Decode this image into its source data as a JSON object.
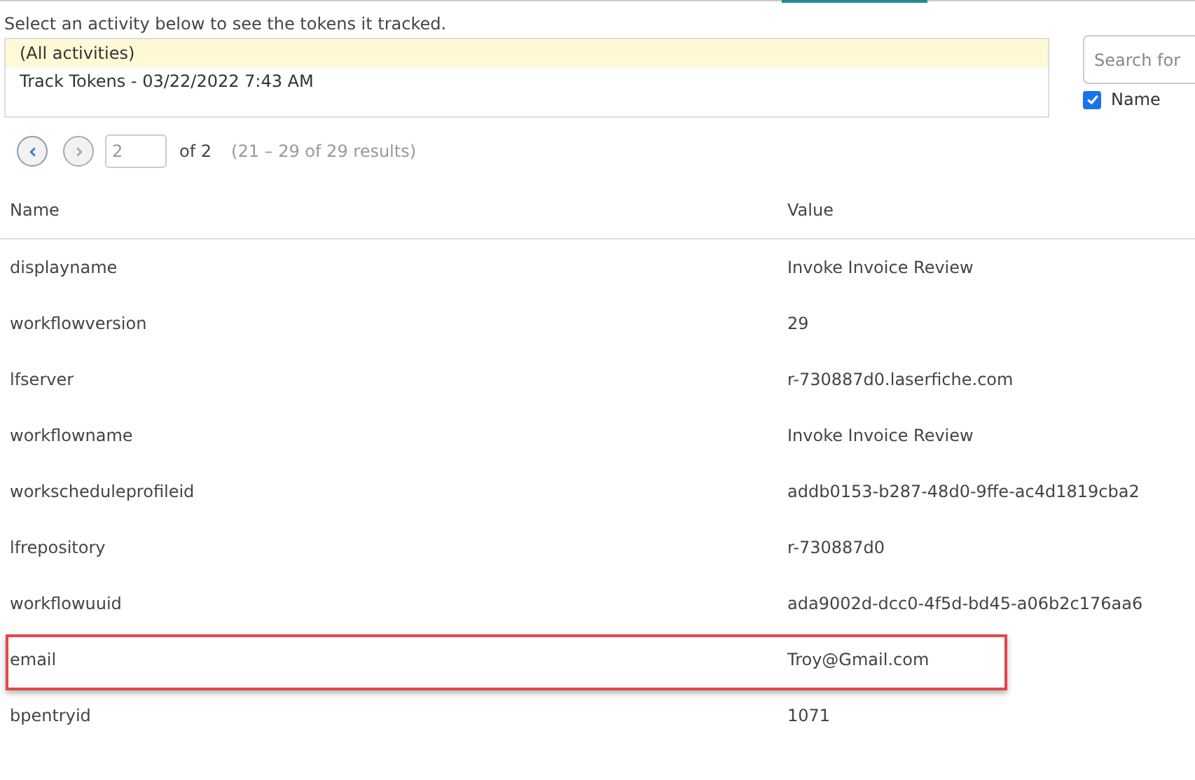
{
  "instruction": "Select an activity below to see the tokens it tracked.",
  "activities": [
    {
      "label": "(All activities)",
      "selected": true
    },
    {
      "label": "Track Tokens - 03/22/2022 7:43 AM",
      "selected": false
    }
  ],
  "search": {
    "placeholder": "Search for"
  },
  "filter": {
    "label": "Name",
    "checked": true
  },
  "pagination": {
    "page": "2",
    "of": "of 2",
    "results": "(21 – 29 of 29 results)"
  },
  "table": {
    "columns": [
      "Name",
      "Value"
    ],
    "rows": [
      {
        "name": "displayname",
        "value": "Invoke Invoice Review",
        "highlighted": false
      },
      {
        "name": "workflowversion",
        "value": "29",
        "highlighted": false
      },
      {
        "name": "lfserver",
        "value": "r-730887d0.laserfiche.com",
        "highlighted": false
      },
      {
        "name": "workflowname",
        "value": "Invoke Invoice Review",
        "highlighted": false
      },
      {
        "name": "workscheduleprofileid",
        "value": "addb0153-b287-48d0-9ffe-ac4d1819cba2",
        "highlighted": false
      },
      {
        "name": "lfrepository",
        "value": "r-730887d0",
        "highlighted": false
      },
      {
        "name": "workflowuuid",
        "value": "ada9002d-dcc0-4f5d-bd45-a06b2c176aa6",
        "highlighted": false
      },
      {
        "name": "email",
        "value": "Troy@Gmail.com",
        "highlighted": true
      },
      {
        "name": "bpentryid",
        "value": "1071",
        "highlighted": false
      }
    ]
  }
}
